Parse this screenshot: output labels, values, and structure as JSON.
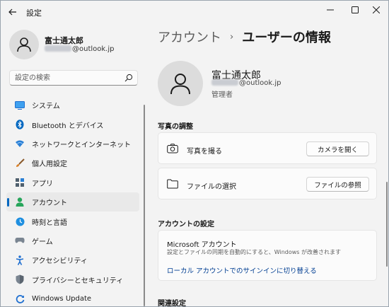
{
  "window": {
    "title": "設定"
  },
  "sidebar": {
    "profile": {
      "name": "富士通太郎",
      "email_suffix": "@outlook.jp"
    },
    "search": {
      "placeholder": "設定の検索"
    },
    "items": [
      {
        "label": "システム",
        "icon": "system-icon",
        "color": "#1f8fe0"
      },
      {
        "label": "Bluetooth とデバイス",
        "icon": "bluetooth-icon",
        "color": "#0067c0"
      },
      {
        "label": "ネットワークとインターネット",
        "icon": "wifi-icon",
        "color": "#2a7fd4"
      },
      {
        "label": "個人用設定",
        "icon": "paintbrush-icon",
        "color": "#d9822b"
      },
      {
        "label": "アプリ",
        "icon": "apps-icon",
        "color": "#50606e"
      },
      {
        "label": "アカウント",
        "icon": "account-icon",
        "color": "#27a55b",
        "active": true
      },
      {
        "label": "時刻と言語",
        "icon": "time-language-icon",
        "color": "#1f8fe0"
      },
      {
        "label": "ゲーム",
        "icon": "gamepad-icon",
        "color": "#7a8591"
      },
      {
        "label": "アクセシビリティ",
        "icon": "accessibility-icon",
        "color": "#1f6fd0"
      },
      {
        "label": "プライバシーとセキュリティ",
        "icon": "shield-icon",
        "color": "#7a8591"
      },
      {
        "label": "Windows Update",
        "icon": "windows-update-icon",
        "color": "#1f6fd0"
      }
    ]
  },
  "breadcrumb": {
    "parent": "アカウント",
    "separator": "›",
    "current": "ユーザーの情報"
  },
  "user": {
    "name": "富士通太郎",
    "email_suffix": "@outlook.jp",
    "role": "管理者"
  },
  "photo_section": {
    "title": "写真の調整",
    "camera": {
      "label": "写真を撮る",
      "button": "カメラを開く"
    },
    "file": {
      "label": "ファイルの選択",
      "button": "ファイルの参照"
    }
  },
  "account_settings": {
    "title": "アカウントの設定",
    "ms_title": "Microsoft アカウント",
    "ms_desc": "設定とファイルの同期を自動的にすると、Windows が改善されます",
    "link": "ローカル アカウントでのサインインに切り替える"
  },
  "related": {
    "title": "関連設定"
  },
  "colors": {
    "accent": "#0067c0",
    "link": "#003e92",
    "background": "#f3f3f3",
    "card": "#fbfbfb"
  }
}
